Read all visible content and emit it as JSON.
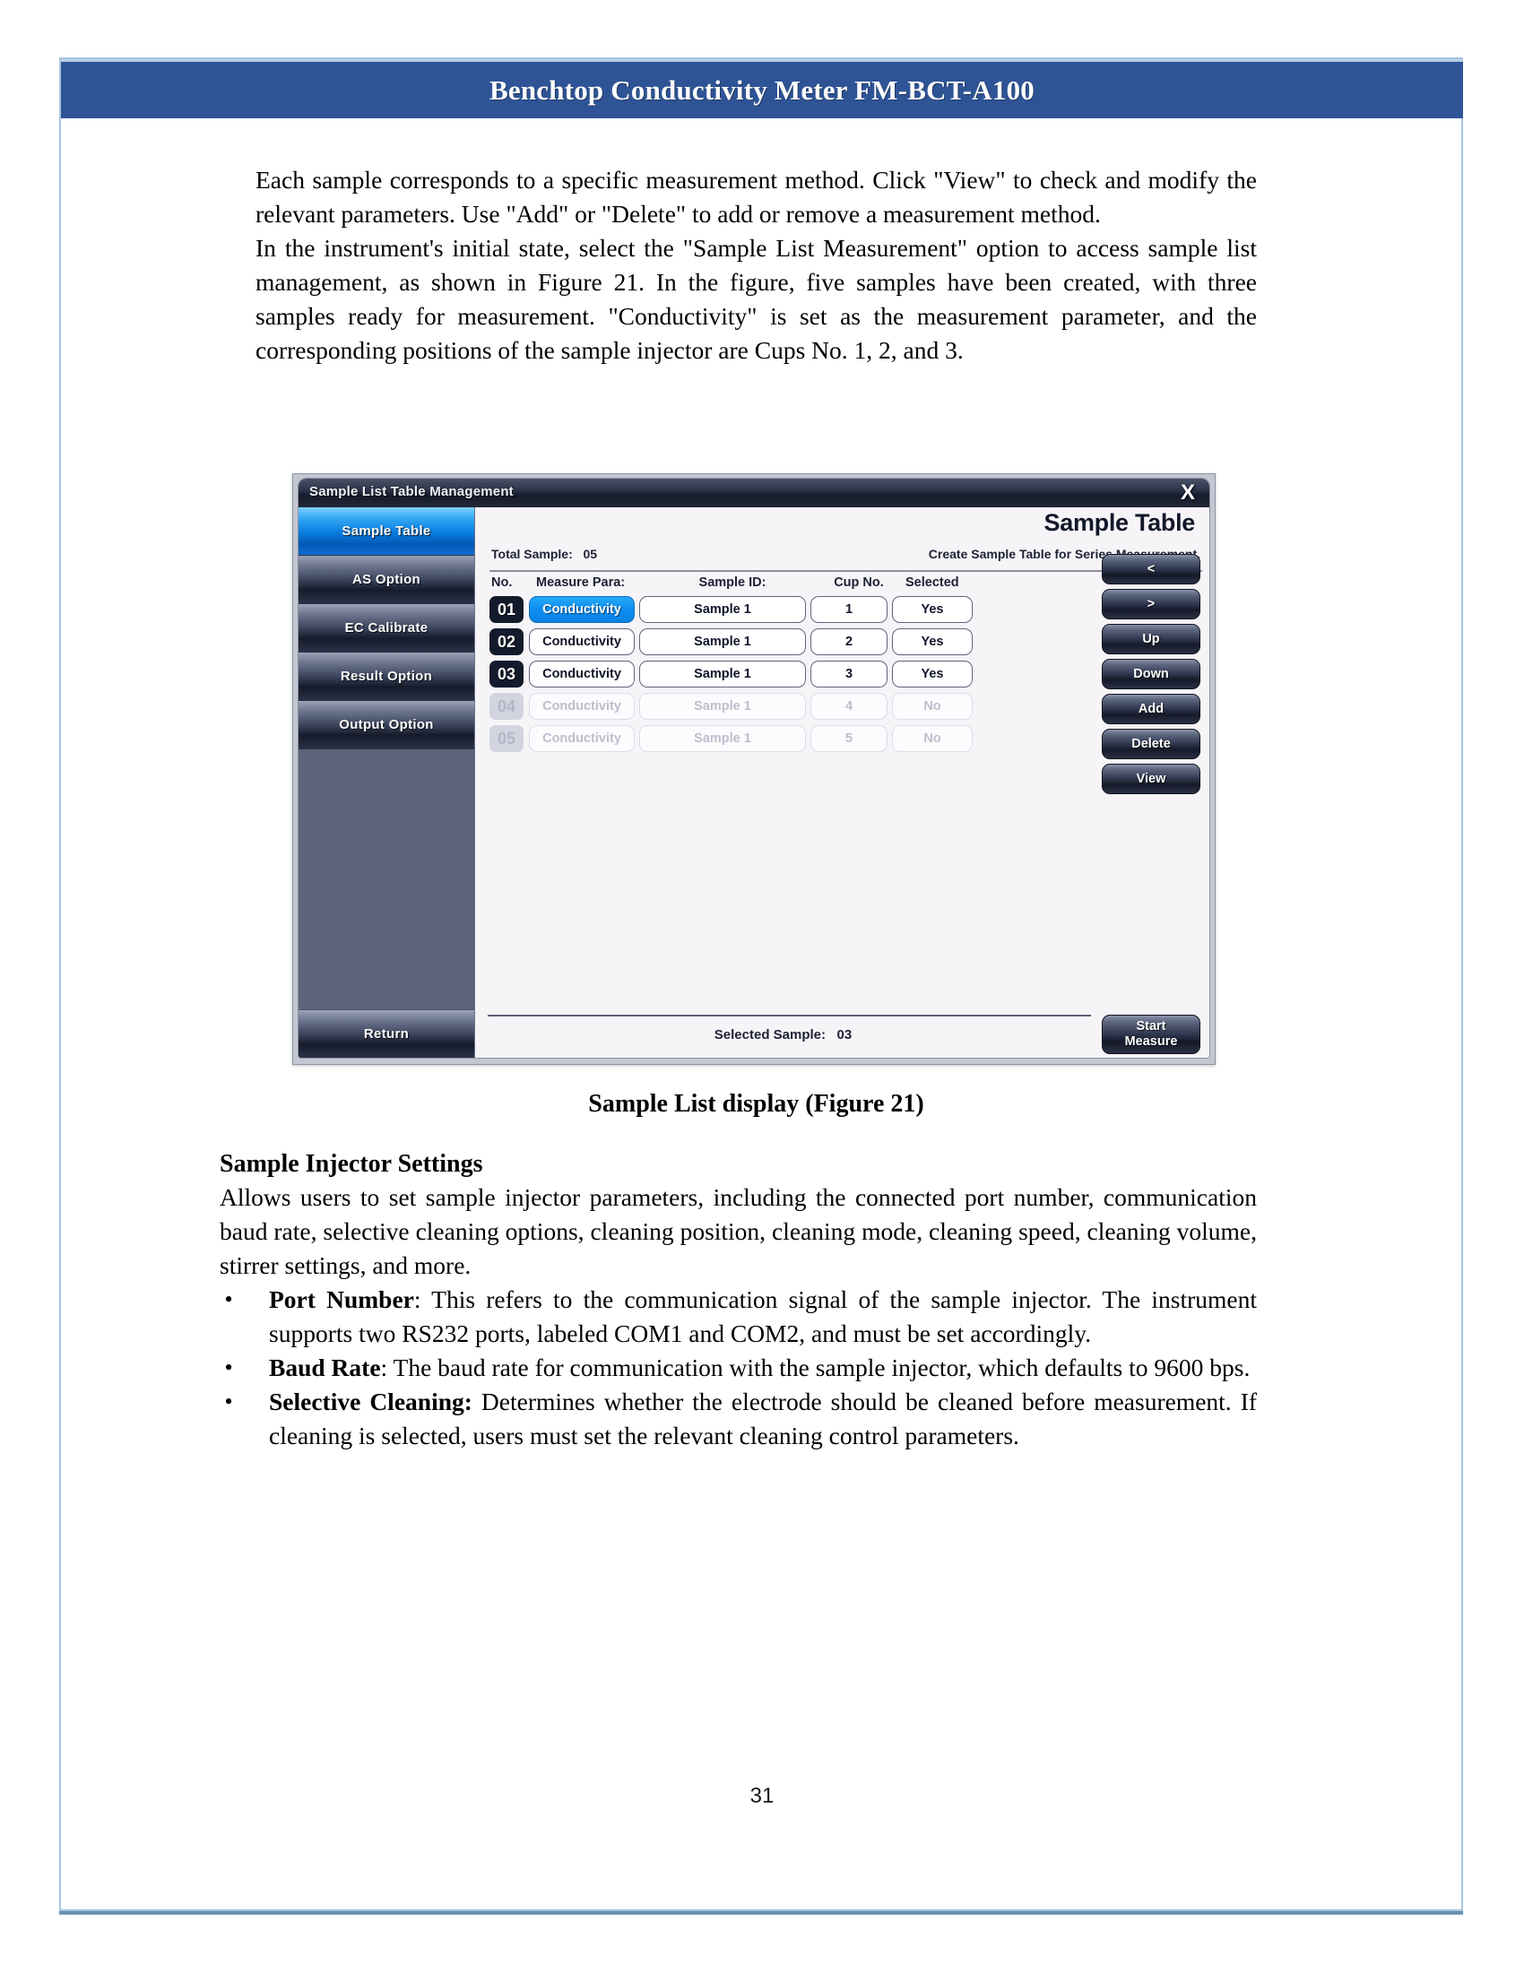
{
  "header": {
    "title": "Benchtop Conductivity Meter FM-BCT-A100"
  },
  "body": {
    "paragraph_1": "Each sample corresponds to a specific measurement method. Click \"View\" to check and modify the relevant parameters. Use \"Add\" or \"Delete\" to add or remove a measurement method.",
    "paragraph_2": "In the instrument's initial state, select the \"Sample List Measurement\" option to access sample list management, as shown in Figure 21. In the figure, five samples have been created, with three samples ready for measurement. \"Conductivity\" is set as the measurement parameter, and the corresponding positions of the sample injector are Cups No. 1, 2, and 3.",
    "figure_caption": "Sample List display (Figure 21)",
    "section_heading": "Sample Injector Settings",
    "section_intro": "Allows users to set sample injector parameters, including the connected port number, communication baud rate, selective cleaning options, cleaning position, cleaning mode, cleaning speed, cleaning volume, stirrer settings, and more.",
    "bullets": [
      {
        "marker": "•",
        "term": "Port Number",
        "text": ": This refers to the communication signal of the sample injector. The instrument supports two RS232 ports, labeled COM1 and COM2, and must be set accordingly."
      },
      {
        "marker": "•",
        "term": "Baud Rate",
        "text": ": The baud rate for communication with the sample injector, which defaults to 9600 bps."
      },
      {
        "marker": "•",
        "term": "Selective Cleaning:",
        "text": " Determines whether the electrode should be cleaned before measurement. If cleaning is selected, users must set the relevant cleaning control parameters."
      }
    ],
    "page_number": "31"
  },
  "figure": {
    "window": {
      "titlebar_text": "Sample List Table Management",
      "close_icon": "X"
    },
    "nav": {
      "items": [
        {
          "label": "Sample Table",
          "active": true
        },
        {
          "label": "AS Option",
          "active": false
        },
        {
          "label": "EC Calibrate",
          "active": false
        },
        {
          "label": "Result Option",
          "active": false
        },
        {
          "label": "Output Option",
          "active": false
        }
      ],
      "return_label": "Return"
    },
    "main": {
      "screen_title": "Sample Table",
      "total_sample_label": "Total Sample:",
      "total_sample_value": "05",
      "hint": "Create Sample Table for Series Measurement.",
      "columns": [
        "No.",
        "Measure Para:",
        "Sample ID:",
        "Cup No.",
        "Selected"
      ],
      "rows": [
        {
          "no": "01",
          "measure_para": "Conductivity",
          "sample_id": "Sample 1",
          "cup_no": "1",
          "selected": "Yes",
          "enabled": true,
          "para_highlighted": true
        },
        {
          "no": "02",
          "measure_para": "Conductivity",
          "sample_id": "Sample 1",
          "cup_no": "2",
          "selected": "Yes",
          "enabled": true,
          "para_highlighted": false
        },
        {
          "no": "03",
          "measure_para": "Conductivity",
          "sample_id": "Sample 1",
          "cup_no": "3",
          "selected": "Yes",
          "enabled": true,
          "para_highlighted": false
        },
        {
          "no": "04",
          "measure_para": "Conductivity",
          "sample_id": "Sample 1",
          "cup_no": "4",
          "selected": "No",
          "enabled": false,
          "para_highlighted": false
        },
        {
          "no": "05",
          "measure_para": "Conductivity",
          "sample_id": "Sample 1",
          "cup_no": "5",
          "selected": "No",
          "enabled": false,
          "para_highlighted": false
        }
      ],
      "side_buttons": [
        "<",
        ">",
        "Up",
        "Down",
        "Add",
        "Delete",
        "View"
      ],
      "start_button_line1": "Start",
      "start_button_line2": "Measure",
      "selected_sample_label": "Selected Sample:",
      "selected_sample_value": "03"
    }
  },
  "colors": {
    "banner_blue": "#2e5496",
    "page_border": "#a8c6e0",
    "nav_active_blue": "#0a7ee0",
    "highlight_blue": "#0d8ef0",
    "panel_bg": "#f7f4f8"
  }
}
